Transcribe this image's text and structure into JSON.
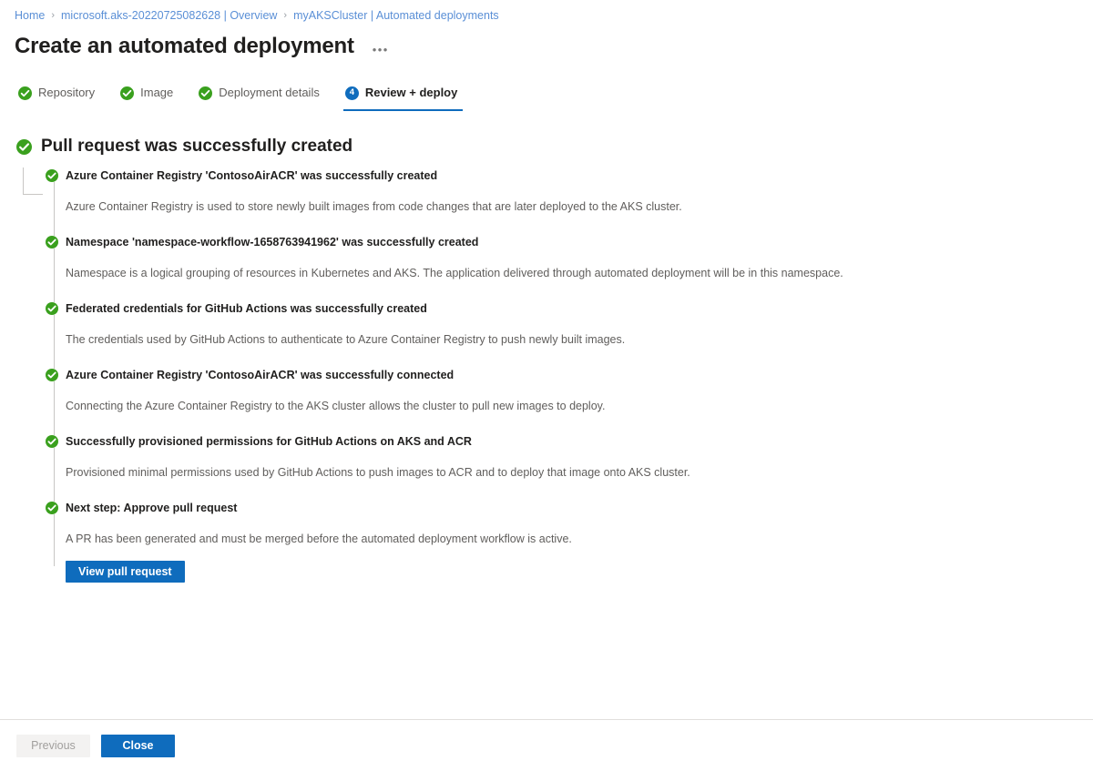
{
  "breadcrumb": {
    "separator": "›",
    "items": [
      {
        "label": "Home"
      },
      {
        "label": "microsoft.aks-20220725082628 | Overview"
      },
      {
        "label": "myAKSCluster | Automated deployments"
      }
    ]
  },
  "header": {
    "title": "Create an automated deployment",
    "more_label": "•••"
  },
  "wizard": {
    "tabs": [
      {
        "label": "Repository",
        "state": "complete",
        "icon": "check-circle-icon"
      },
      {
        "label": "Image",
        "state": "complete",
        "icon": "check-circle-icon"
      },
      {
        "label": "Deployment details",
        "state": "complete",
        "icon": "check-circle-icon"
      },
      {
        "label": "Review + deploy",
        "state": "active",
        "badge": "4"
      }
    ]
  },
  "result": {
    "title": "Pull request was successfully created",
    "icon": "check-circle-icon",
    "items": [
      {
        "title": "Azure Container Registry 'ContosoAirACR' was successfully created",
        "description": "Azure Container Registry is used to store newly built images from code changes that are later deployed to the AKS cluster."
      },
      {
        "title": "Namespace 'namespace-workflow-1658763941962' was successfully created",
        "description": "Namespace is a logical grouping of resources in Kubernetes and AKS. The application delivered through automated deployment will be in this namespace."
      },
      {
        "title": "Federated credentials for GitHub Actions was successfully created",
        "description": "The credentials used by GitHub Actions to authenticate to Azure Container Registry to push newly built images."
      },
      {
        "title": "Azure Container Registry 'ContosoAirACR' was successfully connected",
        "description": "Connecting the Azure Container Registry to the AKS cluster allows the cluster to pull new images to deploy."
      },
      {
        "title": "Successfully provisioned permissions for GitHub Actions on AKS and ACR",
        "description": "Provisioned minimal permissions used by GitHub Actions to push images to ACR and to deploy that image onto AKS cluster."
      },
      {
        "title": "Next step: Approve pull request",
        "description": "A PR has been generated and must be merged before the automated deployment workflow is active.",
        "button": "View pull request"
      }
    ]
  },
  "footer": {
    "previous_label": "Previous",
    "close_label": "Close"
  },
  "colors": {
    "accent_blue": "#0f6cbd",
    "link_blue": "#5a8fd6",
    "success_green": "#3aa01e",
    "text_primary": "#201f1e",
    "text_secondary": "#605e5c",
    "rail": "#c8c6c4"
  }
}
